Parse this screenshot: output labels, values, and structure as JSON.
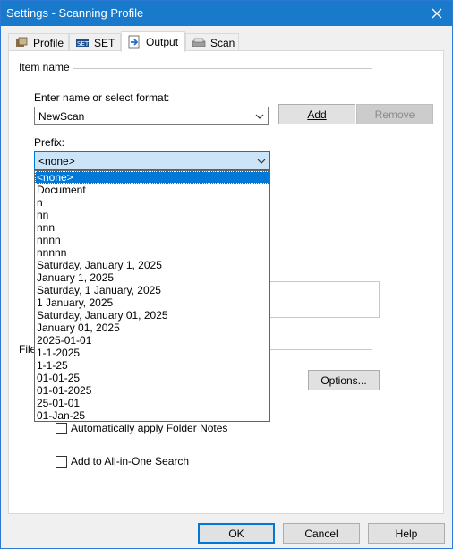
{
  "window": {
    "title": "Settings - Scanning Profile"
  },
  "tabs": [
    {
      "label": "Profile",
      "icon": "profile-icon"
    },
    {
      "label": "SET",
      "icon": "set-icon"
    },
    {
      "label": "Output",
      "icon": "output-icon"
    },
    {
      "label": "Scan",
      "icon": "scan-icon"
    }
  ],
  "item_name": {
    "group_label": "Item name",
    "name_label": "Enter name or select format:",
    "name_value": "NewScan",
    "add_label": "Add",
    "remove_label": "Remove",
    "prefix_label": "Prefix:",
    "prefix_value": "<none>",
    "prefix_options": [
      "<none>",
      "Document",
      "n",
      "nn",
      "nnn",
      "nnnn",
      "nnnnn",
      "Saturday, January 1, 2025",
      "January 1, 2025",
      "Saturday, 1 January, 2025",
      "1 January, 2025",
      "Saturday, January 01, 2025",
      "January 01, 2025",
      "2025-01-01",
      "1-1-2025",
      "1-1-25",
      "01-01-25",
      "01-01-2025",
      "25-01-01",
      "01-Jan-25"
    ]
  },
  "file_group": {
    "label_fragment": "File"
  },
  "options_label": "Options...",
  "auto_folder_notes_label": "Automatically apply Folder Notes",
  "all_in_one_label": "Add to All-in-One Search",
  "footer": {
    "ok": "OK",
    "cancel": "Cancel",
    "help": "Help"
  },
  "colors": {
    "titlebar": "#1979ca",
    "selection": "#0078d7",
    "accent_border": "#0078d7"
  }
}
